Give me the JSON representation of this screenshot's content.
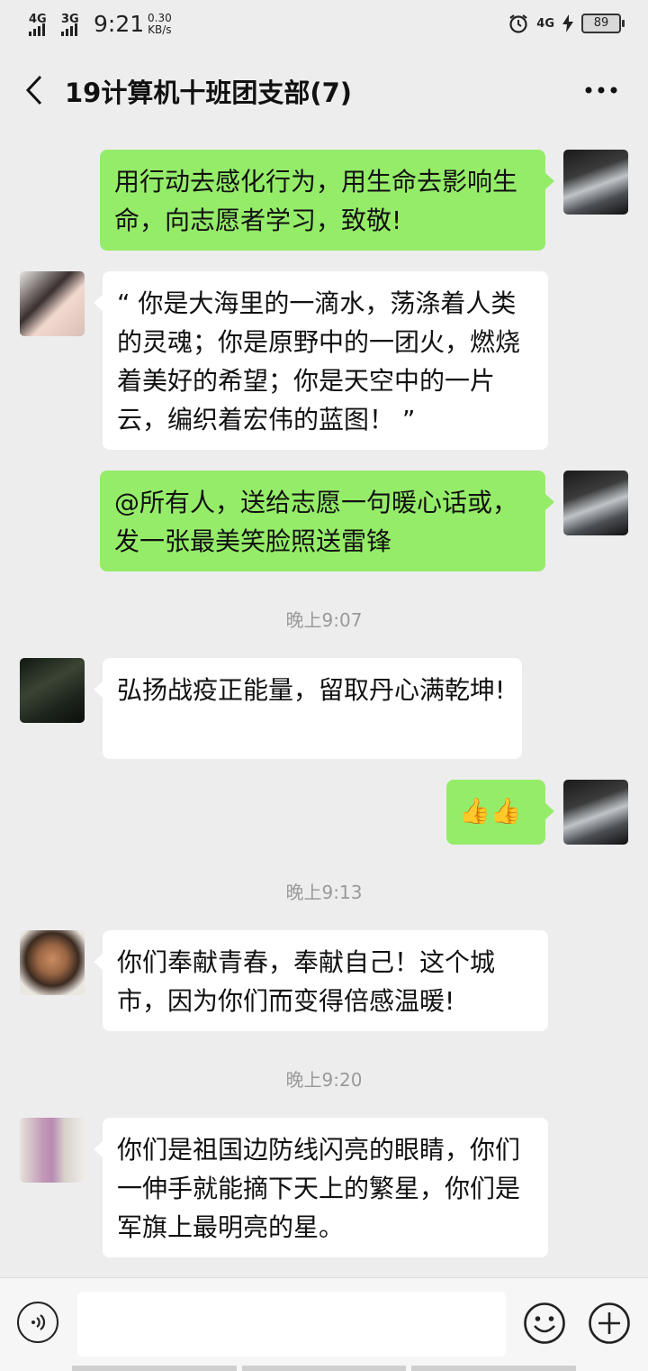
{
  "status_bar": {
    "net1": "4G",
    "net2": "3G",
    "time": "9:21",
    "speed_value": "0.30",
    "speed_unit": "KB/s",
    "net_right": "4G",
    "battery": "89"
  },
  "header": {
    "title": "19计算机十班团支部(7)",
    "back_icon": "chevron-left-icon",
    "more_icon": "more-dots-icon"
  },
  "messages": [
    {
      "side": "out",
      "text": "用行动去感化行为，用生命去影响生命，向志愿者学习，致敬!"
    },
    {
      "side": "in",
      "text": "“ 你是大海里的一滴水，荡涤着人类的灵魂；你是原野中的一团火，燃烧着美好的希望；你是天空中的一片云，编织着宏伟的蓝图！ ”"
    },
    {
      "side": "out",
      "text": "@所有人，送给志愿一句暖心话或，发一张最美笑脸照送雷锋"
    },
    {
      "side": "in",
      "text": "弘扬战疫正能量，留取丹心满乾坤!"
    },
    {
      "side": "out",
      "text": "👍👍"
    },
    {
      "side": "in",
      "text": "你们奉献青春，奉献自己！这个城市，因为你们而变得倍感温暖!"
    },
    {
      "side": "in",
      "text": "你们是祖国边防线闪亮的眼睛，你们一伸手就能摘下天上的繁星，你们是军旗上最明亮的星。"
    }
  ],
  "timestamps": [
    "晚上9:07",
    "晚上9:13",
    "晚上9:20"
  ],
  "input_bar": {
    "voice_icon": "voice-icon",
    "input_value": "",
    "emoji_icon": "emoji-icon",
    "plus_icon": "plus-icon"
  },
  "colors": {
    "background": "#ededed",
    "outgoing_bubble": "#95ec69",
    "incoming_bubble": "#ffffff",
    "timestamp": "#9a9a9a"
  }
}
